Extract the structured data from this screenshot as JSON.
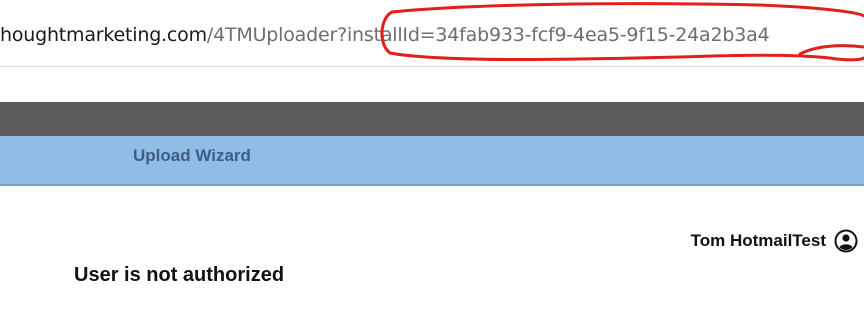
{
  "browser": {
    "url_host": "houghtmarketing.com",
    "url_path": "/4TMUploader",
    "url_query": "?installId=34fab933-fcf9-4ea5-9f15-24a2b3a4",
    "annotation_color": "#e0201b"
  },
  "nav": {
    "tabs": [
      {
        "label": "Upload Wizard"
      }
    ],
    "background": "#8fbde6",
    "tab_color": "#3c5f86"
  },
  "header": {
    "bar_color": "#5b5b5b"
  },
  "user": {
    "name": "Tom HotmailTest",
    "icon": "user-circle-icon"
  },
  "main": {
    "message": "User is not authorized"
  }
}
